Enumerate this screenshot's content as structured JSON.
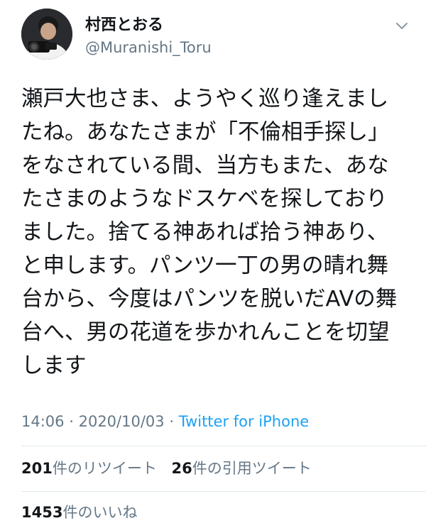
{
  "user": {
    "display_name": "村西とおる",
    "handle": "@Muranishi_Toru"
  },
  "icons": {
    "avatar": "user-avatar-photo",
    "caret": "chevron-down-icon"
  },
  "tweet": {
    "lines": [
      "瀬戸大也さま、ようやく巡り逢えまし",
      "たね。あなたさまが「不倫相手探し」",
      "をなされている間、当方もまた、あな",
      "たさまのようなドスケベを探しており",
      "ました。捨てる神あれば拾う神あり、",
      "と申します。パンツ一丁の男の晴れ舞",
      "台から、今度はパンツを脱いだAVの舞",
      "台へ、男の花道を歩かれんことを切望",
      "します"
    ]
  },
  "meta": {
    "time": "14:06",
    "separator": "·",
    "date": "2020/10/03",
    "source": "Twitter for iPhone"
  },
  "stats": {
    "retweets_count": "201",
    "retweets_label": "件のリツイート",
    "quotes_count": "26",
    "quotes_label": "件の引用ツイート",
    "likes_count": "1453",
    "likes_label": "件のいいね"
  },
  "colors": {
    "text": "#14171a",
    "muted": "#657786",
    "link": "#1da1f2",
    "divider": "#e1e8ed"
  }
}
